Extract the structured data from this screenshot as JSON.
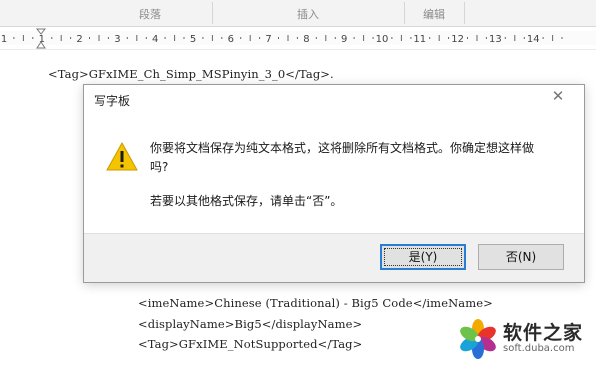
{
  "ribbon": {
    "groups": [
      "段落",
      "插入",
      "编辑"
    ]
  },
  "ruler": {
    "numbers": [
      "1",
      "1",
      "2",
      "3",
      "4",
      "5",
      "6",
      "7",
      "8",
      "9",
      "10",
      "11",
      "12",
      "13",
      "14"
    ]
  },
  "document": {
    "line_top": "<Tag>GFxIME_Ch_Simp_MSPinyin_3_0</Tag>.",
    "line_1": "<imeName>Chinese (Traditional) - Big5 Code</imeName>",
    "line_2": "<displayName>Big5</displayName>",
    "line_3": "<Tag>GFxIME_NotSupported</Tag>"
  },
  "dialog": {
    "title": "写字板",
    "close_glyph": "✕",
    "message": "你要将文档保存为纯文本格式，这将删除所有文档格式。你确定想这样做吗?",
    "hint": "若要以其他格式保存，请单击“否”。",
    "yes_label": "是(Y)",
    "no_label": "否(N)",
    "icon": "warning-icon",
    "warning_color": "#f5c400"
  },
  "watermark": {
    "name": "软件之家",
    "url": "soft.duba.com"
  }
}
